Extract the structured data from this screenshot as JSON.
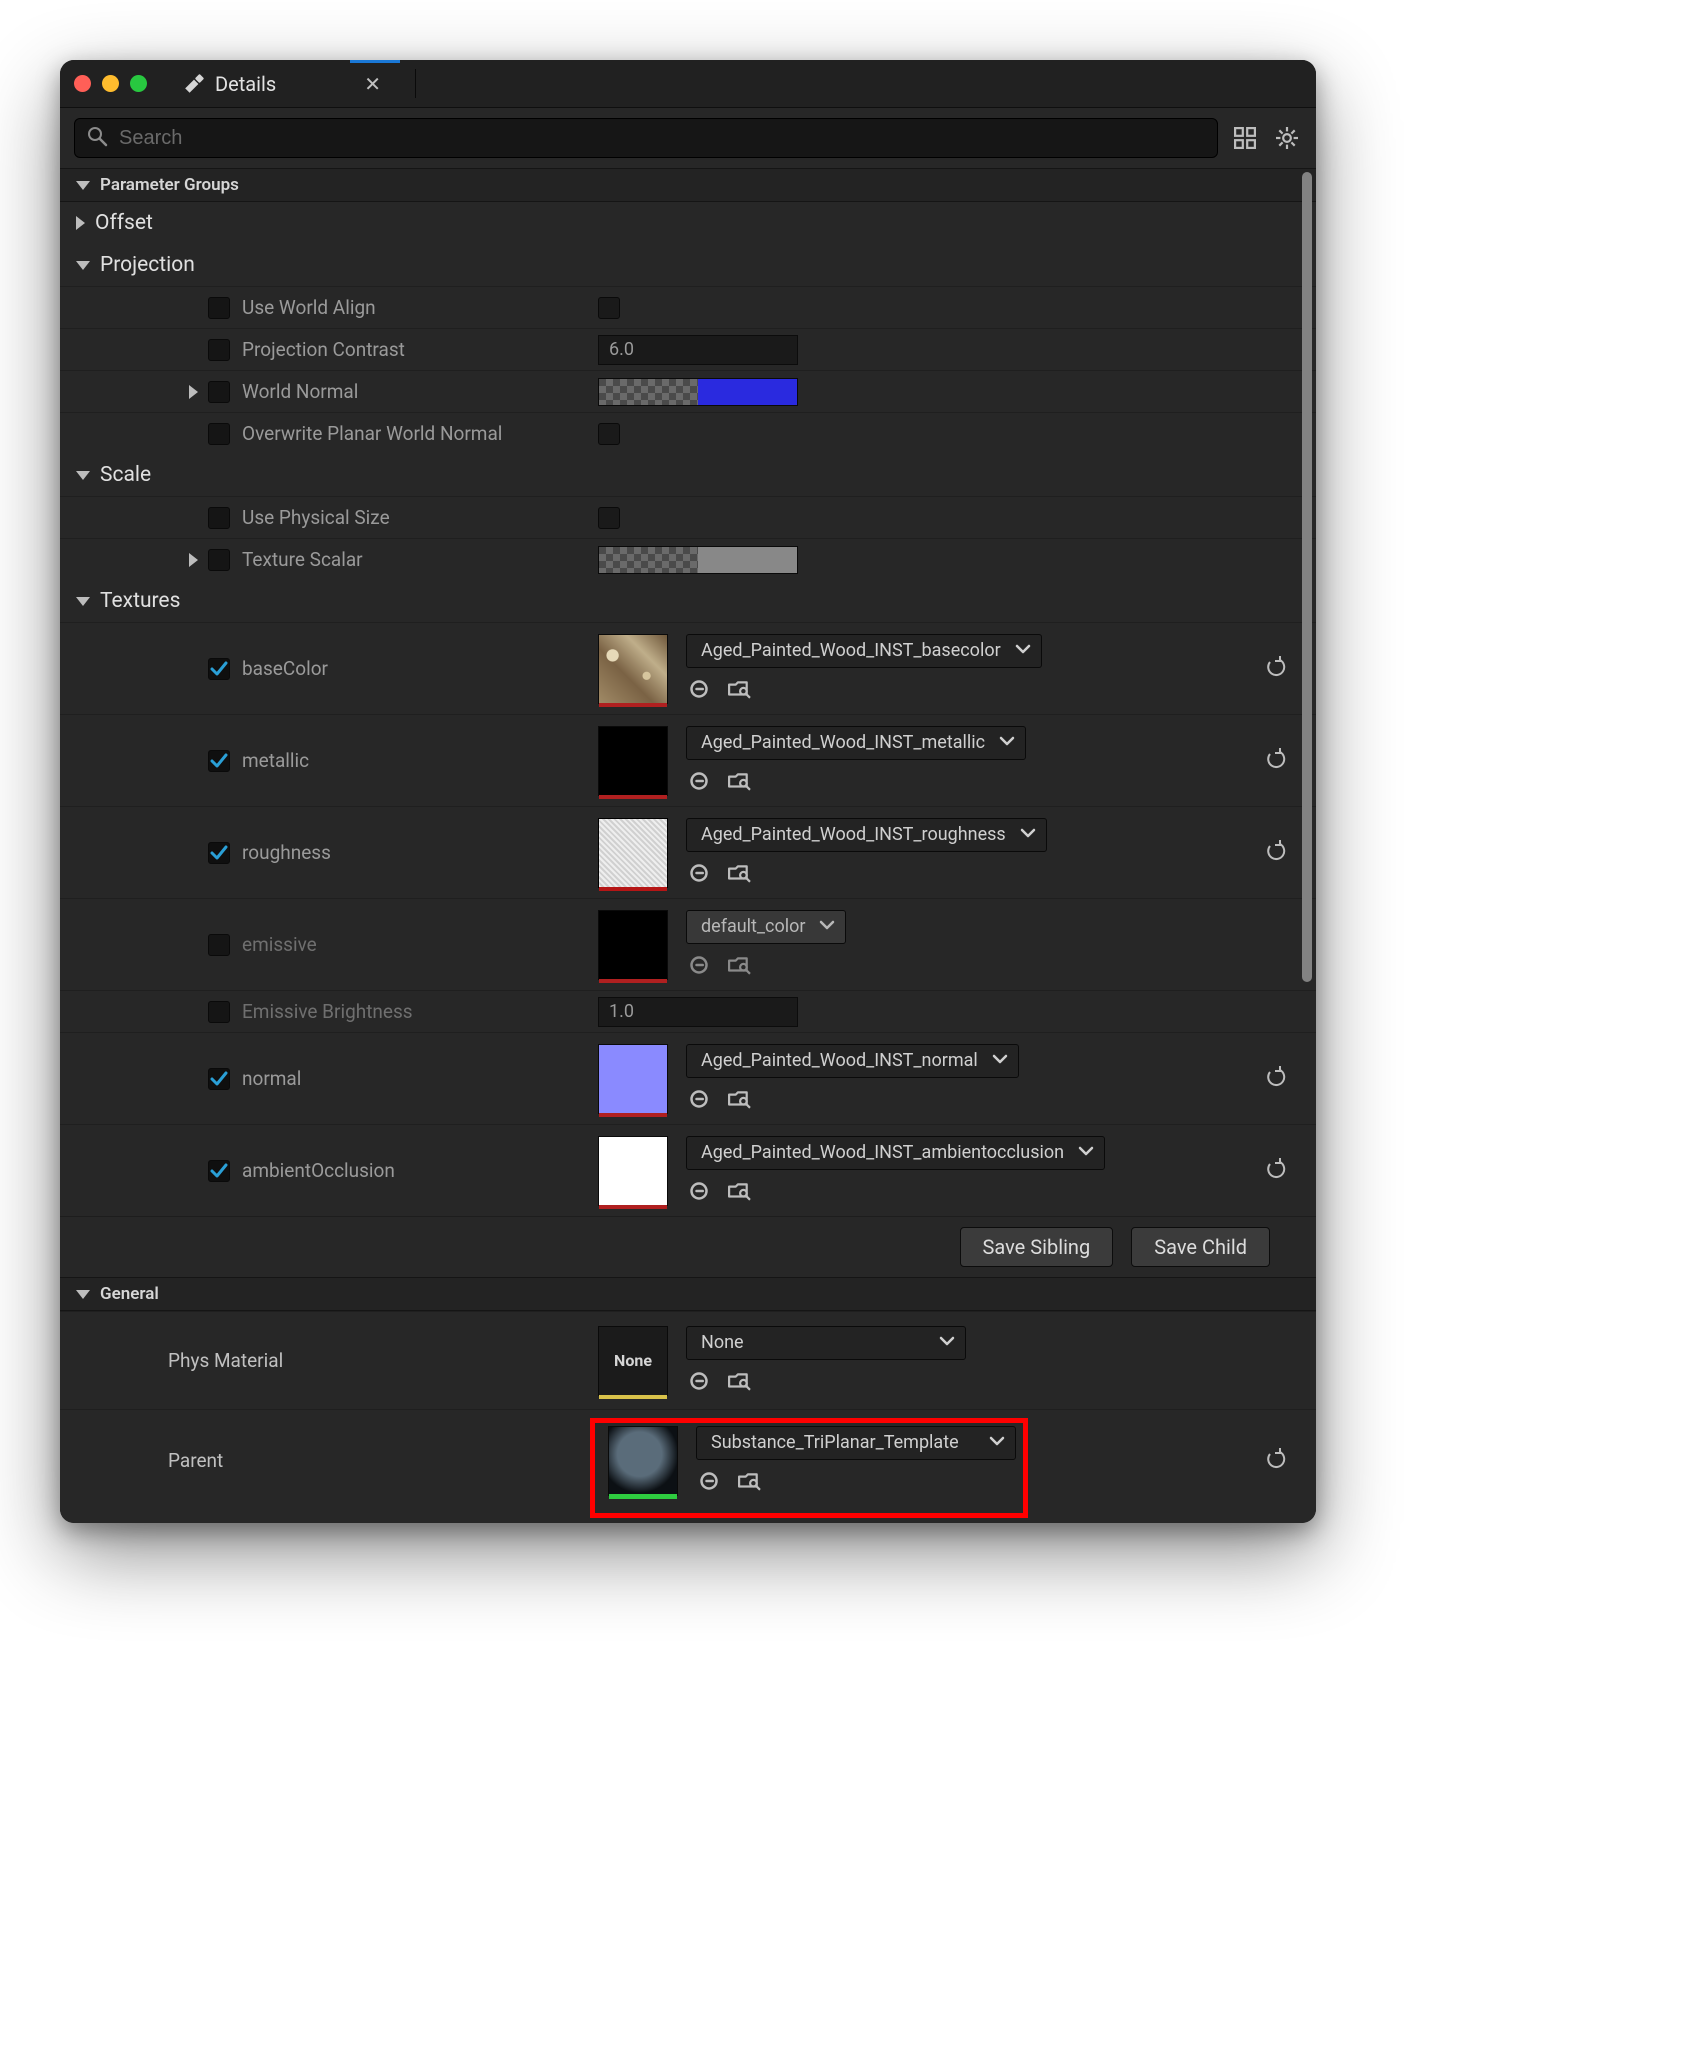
{
  "window": {
    "title": "Details"
  },
  "search": {
    "placeholder": "Search"
  },
  "sections": {
    "parameter_groups": {
      "label": "Parameter Groups"
    },
    "offset": {
      "label": "Offset"
    },
    "projection": {
      "label": "Projection",
      "use_world_align": {
        "label": "Use World Align"
      },
      "projection_contrast": {
        "label": "Projection Contrast",
        "value": "6.0"
      },
      "world_normal": {
        "label": "World Normal"
      },
      "overwrite_planar": {
        "label": "Overwrite Planar World Normal"
      }
    },
    "scale": {
      "label": "Scale",
      "use_physical_size": {
        "label": "Use Physical Size"
      },
      "texture_scalar": {
        "label": "Texture Scalar"
      }
    },
    "textures": {
      "label": "Textures",
      "basecolor": {
        "label": "baseColor",
        "asset": "Aged_Painted_Wood_INST_basecolor"
      },
      "metallic": {
        "label": "metallic",
        "asset": "Aged_Painted_Wood_INST_metallic"
      },
      "roughness": {
        "label": "roughness",
        "asset": "Aged_Painted_Wood_INST_roughness"
      },
      "emissive": {
        "label": "emissive",
        "asset": "default_color"
      },
      "emissive_brightness": {
        "label": "Emissive Brightness",
        "value": "1.0"
      },
      "normal": {
        "label": "normal",
        "asset": "Aged_Painted_Wood_INST_normal"
      },
      "ao": {
        "label": "ambientOcclusion",
        "asset": "Aged_Painted_Wood_INST_ambientocclusion"
      }
    },
    "general": {
      "label": "General",
      "phys_material": {
        "label": "Phys Material",
        "value": "None",
        "thumb_text": "None"
      },
      "parent": {
        "label": "Parent",
        "value": "Substance_TriPlanar_Template"
      }
    }
  },
  "buttons": {
    "save_sibling": "Save Sibling",
    "save_child": "Save Child"
  }
}
